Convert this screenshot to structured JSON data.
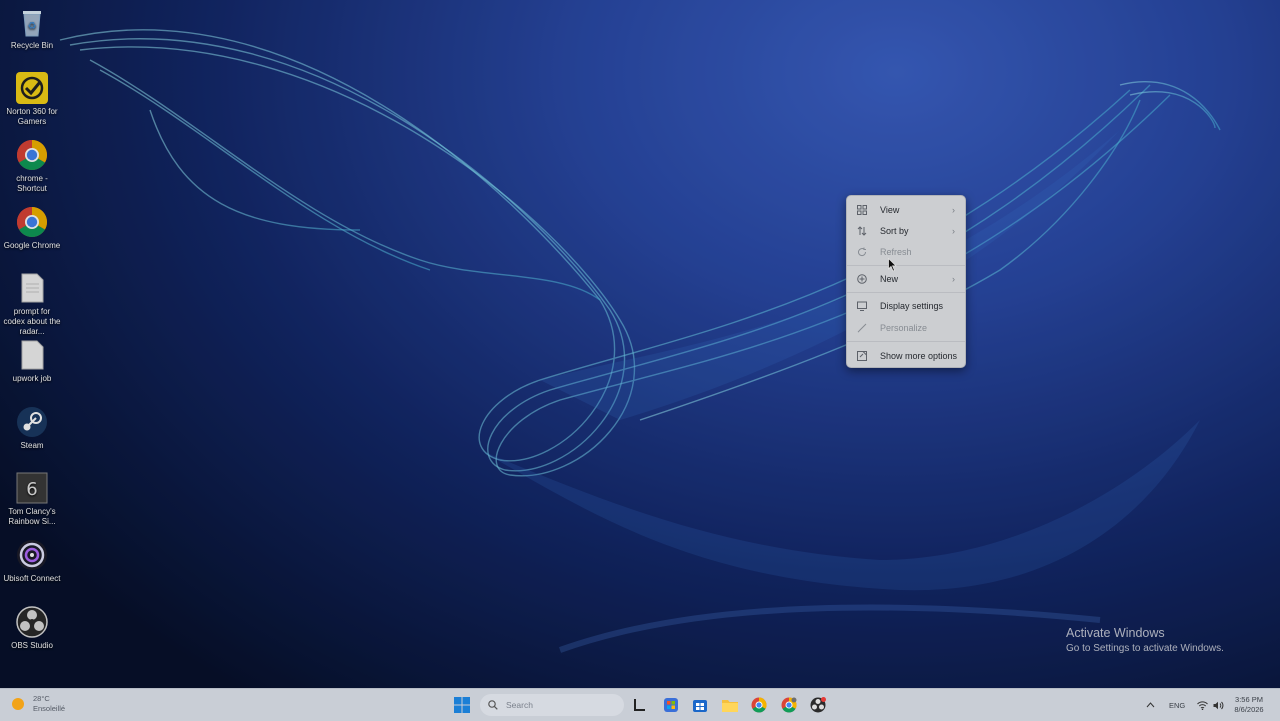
{
  "desktop": {
    "icons": [
      {
        "label": "Recycle Bin",
        "icon": "recycle-bin-icon"
      },
      {
        "label": "Norton 360 for Gamers",
        "icon": "norton-icon"
      },
      {
        "label": "chrome - Shortcut",
        "icon": "chrome-icon"
      },
      {
        "label": "Google Chrome",
        "icon": "chrome-icon"
      },
      {
        "label": "prompt for codex about the radar...",
        "icon": "text-file-icon"
      },
      {
        "label": "upwork job",
        "icon": "text-file-icon"
      },
      {
        "label": "Steam",
        "icon": "steam-icon"
      },
      {
        "label": "Tom Clancy's Rainbow Si...",
        "icon": "rainbow-six-icon"
      },
      {
        "label": "Ubisoft Connect",
        "icon": "ubisoft-icon"
      },
      {
        "label": "OBS Studio",
        "icon": "obs-icon"
      }
    ]
  },
  "context_menu": {
    "items": [
      {
        "label": "View",
        "icon": "view-grid-icon",
        "submenu": true
      },
      {
        "label": "Sort by",
        "icon": "sort-icon",
        "submenu": true
      },
      {
        "label": "Refresh",
        "icon": "refresh-icon",
        "submenu": false
      },
      {
        "label": "New",
        "icon": "new-plus-icon",
        "submenu": true
      },
      {
        "label": "Display settings",
        "icon": "display-icon",
        "submenu": false
      },
      {
        "label": "Personalize",
        "icon": "brush-icon",
        "submenu": false
      },
      {
        "label": "Show more options",
        "icon": "more-options-icon",
        "submenu": false
      }
    ],
    "submenu_arrow": "›"
  },
  "watermark": {
    "title": "Activate Windows",
    "subtitle": "Go to Settings to activate Windows."
  },
  "taskbar": {
    "weather": {
      "temp": "28°C",
      "condition": "Ensoleillé"
    },
    "search": {
      "placeholder": "Search"
    },
    "tray": {
      "language": "ENG"
    },
    "clock": {
      "time": "3:56 PM",
      "date": "8/6/2026"
    }
  },
  "colors": {
    "accent": "#1a73e8",
    "taskbar_bg": "#c9ced6",
    "menu_bg": "#e9ebee"
  }
}
